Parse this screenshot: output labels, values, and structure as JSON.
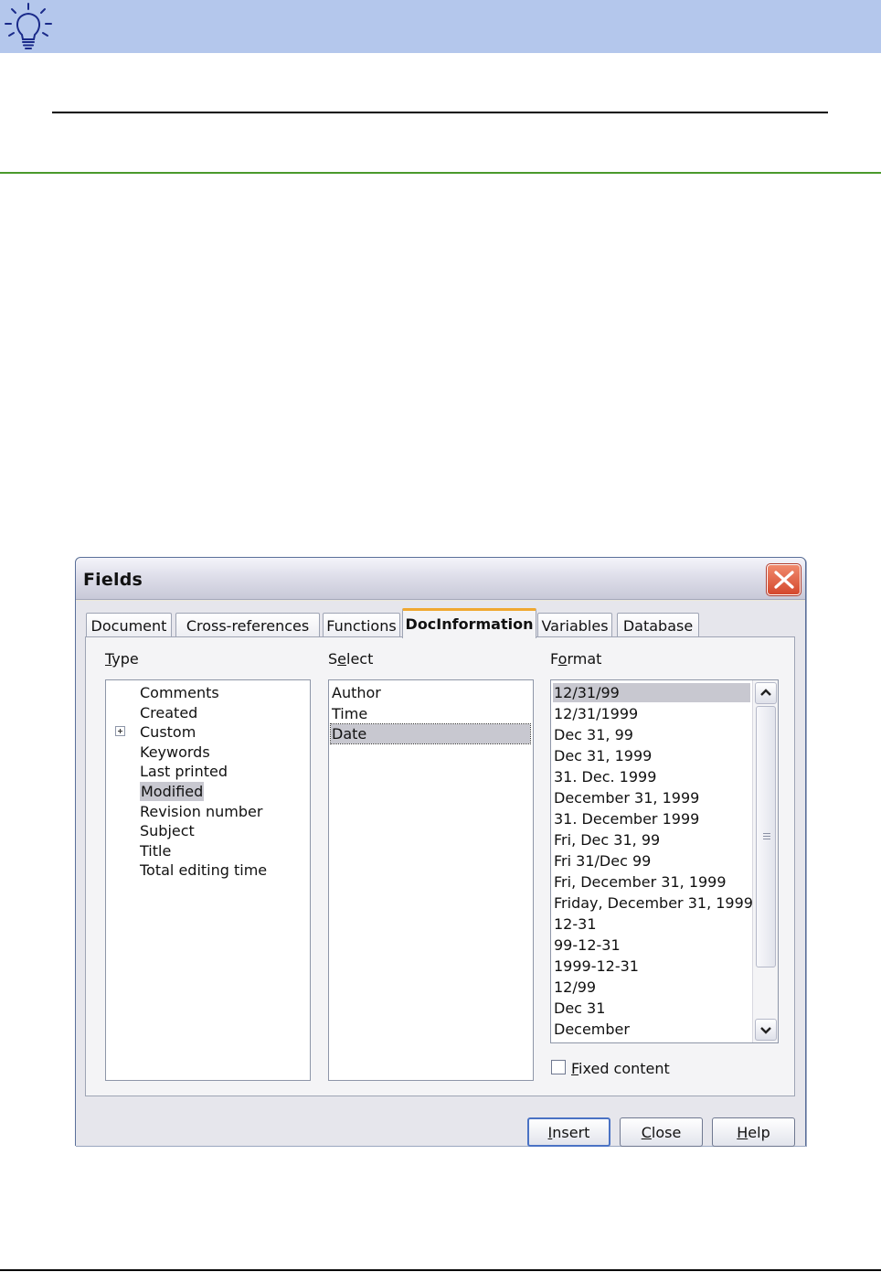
{
  "dialog": {
    "title": "Fields",
    "tabs": [
      {
        "label": "Document"
      },
      {
        "label": "Cross-references"
      },
      {
        "label": "Functions"
      },
      {
        "label": "DocInformation",
        "active": true
      },
      {
        "label": "Variables"
      },
      {
        "label": "Database"
      }
    ],
    "type_label": {
      "mnemonic": "T",
      "rest": "ype"
    },
    "select_label": {
      "before": "S",
      "mnemonic": "e",
      "rest": "lect"
    },
    "format_label": {
      "before": "F",
      "mnemonic": "o",
      "rest": "rmat"
    },
    "type_items": [
      "Comments",
      "Created",
      "Custom",
      "Keywords",
      "Last printed",
      "Modified",
      "Revision number",
      "Subject",
      "Title",
      "Total editing time"
    ],
    "type_selected": "Modified",
    "select_items": [
      "Author",
      "Time",
      "Date"
    ],
    "select_selected": "Date",
    "format_items": [
      "12/31/99",
      "12/31/1999",
      "Dec 31, 99",
      "Dec 31, 1999",
      "31. Dec. 1999",
      "December 31, 1999",
      "31. December 1999",
      "Fri, Dec 31, 99",
      "Fri 31/Dec 99",
      "Fri, December 31, 1999",
      "Friday, December 31, 1999",
      "12-31",
      "99-12-31",
      "1999-12-31",
      "12/99",
      "Dec 31",
      "December"
    ],
    "format_selected": "12/31/99",
    "fixed_content": {
      "mnemonic": "F",
      "rest": "ixed content",
      "checked": false
    },
    "buttons": {
      "insert": {
        "mnemonic": "I",
        "rest": "nsert"
      },
      "close": {
        "mnemonic": "C",
        "rest": "lose"
      },
      "help": {
        "mnemonic": "H",
        "rest": "elp"
      }
    }
  },
  "colors": {
    "tip_band": "#b4c7ec",
    "green_rule": "#4a9a2c",
    "selection": "#c8c8d0",
    "active_tab_accent": "#f0a830",
    "close_button": "#d4482e"
  },
  "icons": {
    "tip": "lightbulb-icon",
    "close": "close-icon",
    "expand": "plus-expander-icon",
    "scroll_up": "chevron-up-icon",
    "scroll_down": "chevron-down-icon"
  }
}
